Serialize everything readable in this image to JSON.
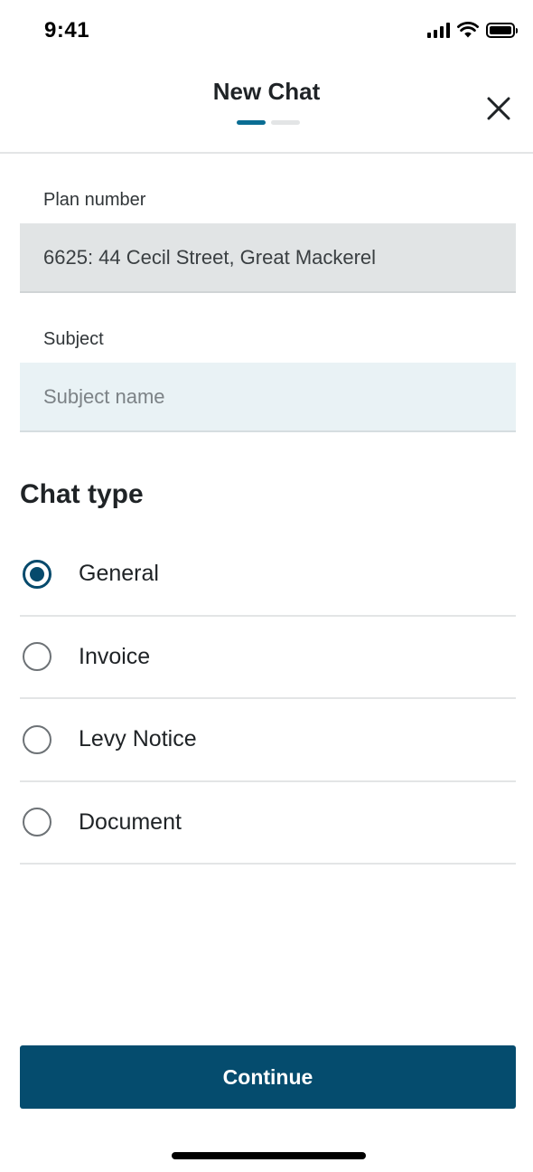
{
  "status_bar": {
    "time": "9:41",
    "icons": [
      "cellular-signal-icon",
      "wifi-icon",
      "battery-icon"
    ]
  },
  "header": {
    "title": "New Chat",
    "steps": {
      "total": 2,
      "current": 1
    },
    "close_icon": "close-icon"
  },
  "plan_field": {
    "label": "Plan number",
    "value": "6625: 44 Cecil Street, Great Mackerel"
  },
  "subject_field": {
    "label": "Subject",
    "placeholder": "Subject name",
    "value": ""
  },
  "chat_type": {
    "title": "Chat type",
    "options": [
      {
        "label": "General",
        "selected": true
      },
      {
        "label": "Invoice",
        "selected": false
      },
      {
        "label": "Levy Notice",
        "selected": false
      },
      {
        "label": "Document",
        "selected": false
      }
    ]
  },
  "actions": {
    "continue_label": "Continue"
  },
  "colors": {
    "primary": "#054c6e",
    "step_active": "#0a6d93",
    "step_inactive": "#e3e5e6",
    "input_bg": "#e9f2f5",
    "disabled_bg": "#e1e4e5"
  }
}
